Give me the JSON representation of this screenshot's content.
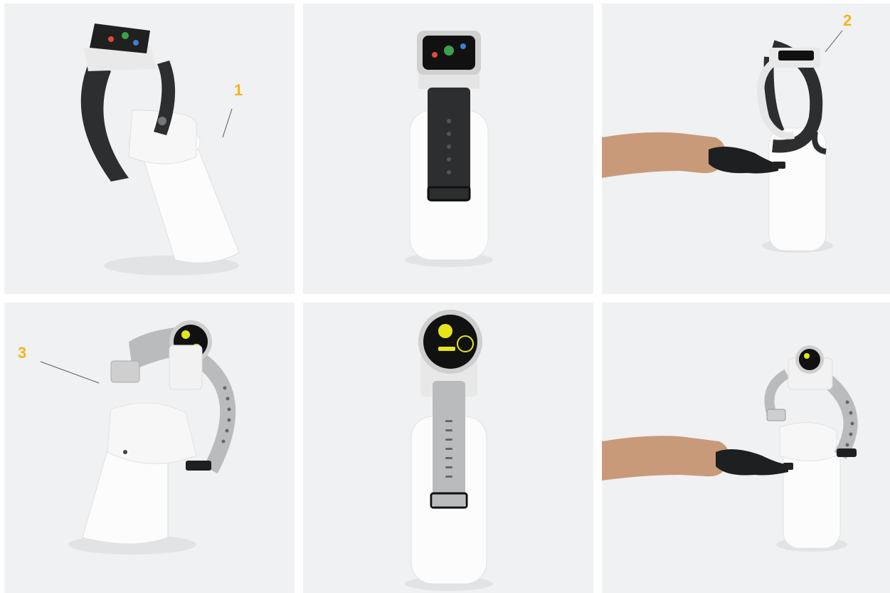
{
  "callouts": {
    "one": "1",
    "two": "2",
    "three": "3"
  },
  "colors": {
    "panel_bg": "#f0f1f2",
    "callout_accent": "#f2b61c",
    "stand_white": "#ffffff",
    "band_dark": "#2c2e30",
    "band_light_grey": "#b9bbbd",
    "screen_dark": "#111111",
    "watch_face_accent": "#e4e61a",
    "skin": "#c99a7a",
    "key_black": "#1e1f20"
  },
  "panels": [
    {
      "subject": "square-watch-stand-tilted",
      "band": "dark"
    },
    {
      "subject": "square-watch-stand-front",
      "band": "dark"
    },
    {
      "subject": "square-watch-stand-hand-key",
      "band": "dark"
    },
    {
      "subject": "round-watch-stand-tilted",
      "band": "light-grey"
    },
    {
      "subject": "round-watch-stand-front",
      "band": "light-grey"
    },
    {
      "subject": "round-watch-stand-hand-key",
      "band": "light-grey"
    }
  ]
}
